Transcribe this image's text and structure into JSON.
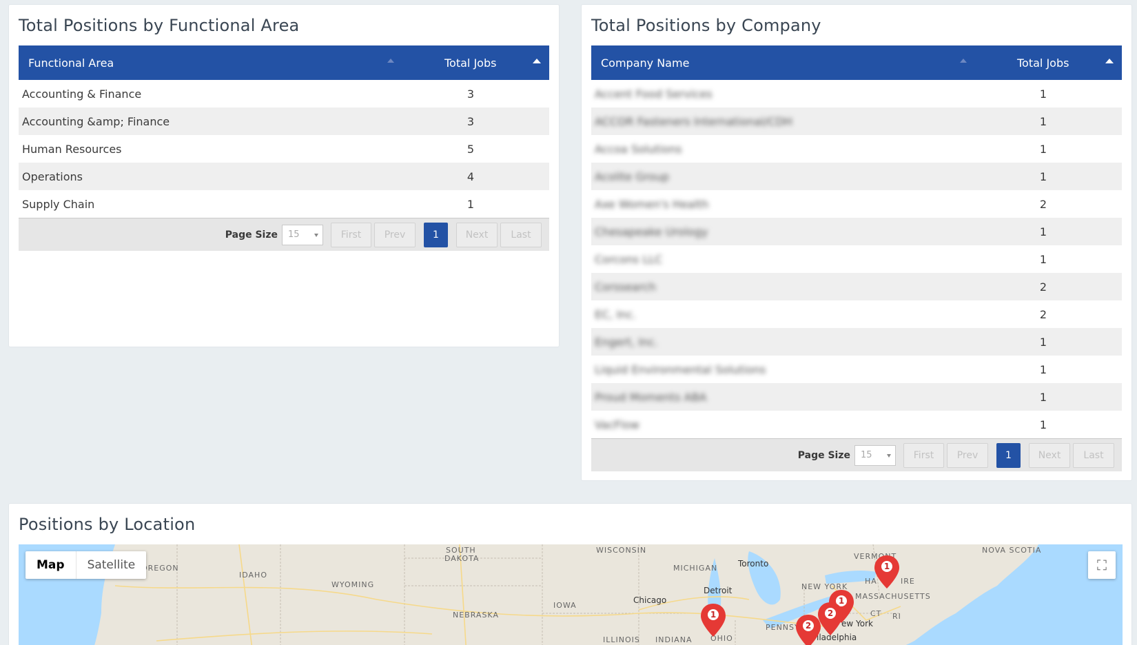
{
  "functional_area": {
    "title": "Total Positions by Functional Area",
    "col_area": "Functional Area",
    "col_jobs": "Total Jobs",
    "rows": [
      {
        "name": "Accounting & Finance",
        "jobs": "3"
      },
      {
        "name": "Accounting &amp; Finance",
        "jobs": "3"
      },
      {
        "name": "Human Resources",
        "jobs": "5"
      },
      {
        "name": "Operations",
        "jobs": "4"
      },
      {
        "name": "Supply Chain",
        "jobs": "1"
      }
    ],
    "pager": {
      "page_size_label": "Page Size",
      "page_size": "15",
      "first": "First",
      "prev": "Prev",
      "current": "1",
      "next": "Next",
      "last": "Last"
    }
  },
  "company": {
    "title": "Total Positions by Company",
    "col_company": "Company Name",
    "col_jobs": "Total Jobs",
    "rows": [
      {
        "name": "Accent Food Services",
        "jobs": "1"
      },
      {
        "name": "ACCOR Fasteners International/CDH",
        "jobs": "1"
      },
      {
        "name": "Accoa Solutions",
        "jobs": "1"
      },
      {
        "name": "Acolite Group",
        "jobs": "1"
      },
      {
        "name": "Axe Women's Health",
        "jobs": "2"
      },
      {
        "name": "Chesapeake Urology",
        "jobs": "1"
      },
      {
        "name": "Corcons LLC",
        "jobs": "1"
      },
      {
        "name": "Corssearch",
        "jobs": "2"
      },
      {
        "name": "EC, Inc.",
        "jobs": "2"
      },
      {
        "name": "Engert, Inc.",
        "jobs": "1"
      },
      {
        "name": "Liquid Environmental Solutions",
        "jobs": "1"
      },
      {
        "name": "Proud Moments ABA",
        "jobs": "1"
      },
      {
        "name": "VacFlow",
        "jobs": "1"
      }
    ],
    "pager": {
      "page_size_label": "Page Size",
      "page_size": "15",
      "first": "First",
      "prev": "Prev",
      "current": "1",
      "next": "Next",
      "last": "Last"
    }
  },
  "location": {
    "title": "Positions by Location",
    "map_btn": "Map",
    "satellite_btn": "Satellite",
    "fullscreen_icon": "fullscreen-icon",
    "labels": {
      "oregon": "OREGON",
      "idaho": "IDAHO",
      "wyoming": "WYOMING",
      "south_dakota_1": "SOUTH",
      "south_dakota_2": "DAKOTA",
      "nebraska": "NEBRASKA",
      "iowa": "IOWA",
      "wisconsin": "WISCONSIN",
      "michigan": "MICHIGAN",
      "illinois": "ILLINOIS",
      "indiana": "INDIANA",
      "ohio": "OHIO",
      "new_york": "NEW YORK",
      "vermont": "VERMONT",
      "massachusetts": "MASSACHUSETTS",
      "ct": "CT",
      "ri": "RI",
      "penns": "PENNSY",
      "nova_scotia": "NOVA SCOTIA",
      "hampshire_1": "HA",
      "hampshire_2": "IRE"
    },
    "cities": {
      "chicago": "Chicago",
      "detroit": "Detroit",
      "toronto": "Toronto",
      "new_york_city": "ew York",
      "philadelphia": "iladelphia"
    },
    "markers": [
      {
        "count": "1"
      },
      {
        "count": "1"
      },
      {
        "count": "2"
      },
      {
        "count": "2"
      },
      {
        "count": "1"
      }
    ],
    "colors": {
      "marker": "#e53935",
      "water": "#aadaff",
      "land": "#eae6dc"
    }
  }
}
